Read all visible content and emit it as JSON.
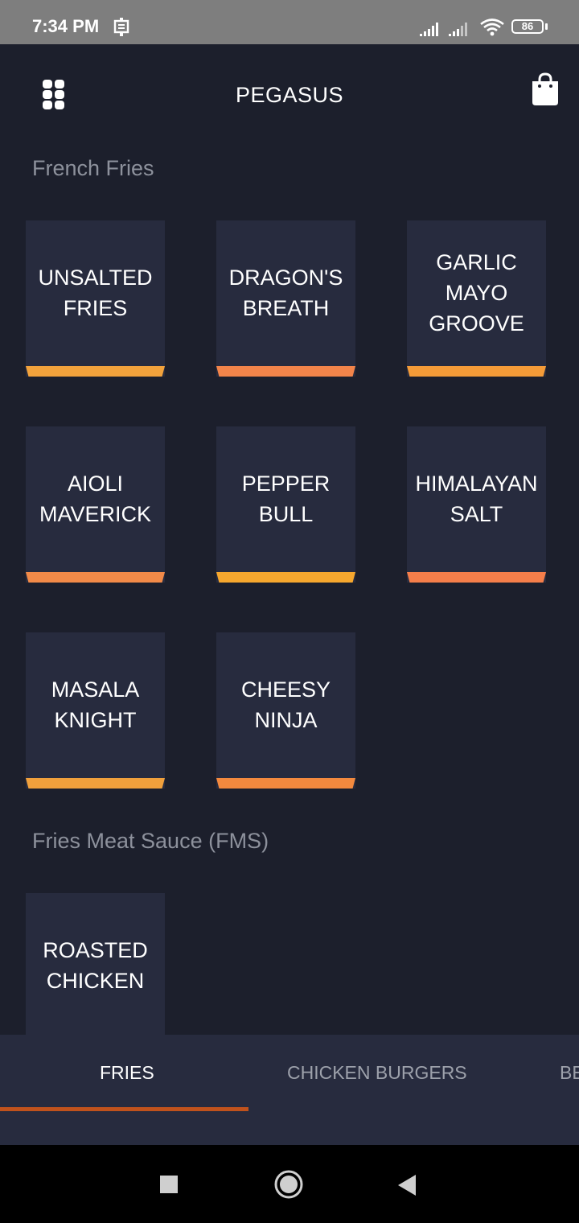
{
  "status_bar": {
    "time": "7:34 PM",
    "battery": "86",
    "icons": [
      "cast-icon",
      "signal-icon",
      "signal-icon",
      "wifi-icon",
      "battery-icon"
    ]
  },
  "header": {
    "title": "PEGASUS",
    "menu_icon": "grid-menu-icon",
    "cart_icon": "shopping-bag-icon"
  },
  "sections": [
    {
      "title": "French Fries",
      "items": [
        {
          "lines": [
            "UNSALTED",
            "FRIES"
          ],
          "accent": "#f2a23c"
        },
        {
          "lines": [
            "DRAGON'S",
            "BREATH"
          ],
          "accent": "#f2844a"
        },
        {
          "lines": [
            "GARLIC",
            "MAYO",
            "GROOVE"
          ],
          "accent": "#f49b38"
        },
        {
          "lines": [
            "AIOLI",
            "MAVERICK"
          ],
          "accent": "#f28a48"
        },
        {
          "lines": [
            "PEPPER",
            "BULL"
          ],
          "accent": "#f6a72e"
        },
        {
          "lines": [
            "HIMALAYAN",
            "SALT"
          ],
          "accent": "#f57e4a"
        },
        {
          "lines": [
            "MASALA",
            "KNIGHT"
          ],
          "accent": "#f0a03c"
        },
        {
          "lines": [
            "CHEESY",
            "NINJA"
          ],
          "accent": "#f3893e"
        }
      ]
    },
    {
      "title": "Fries Meat Sauce (FMS)",
      "items": [
        {
          "lines": [
            "ROASTED",
            "CHICKEN"
          ],
          "accent": "#f2a23c"
        }
      ]
    }
  ],
  "tabs": [
    {
      "label": "FRIES",
      "active": true
    },
    {
      "label": "CHICKEN BURGERS",
      "active": false
    },
    {
      "label": "BEEF BURGERS",
      "active": false
    }
  ],
  "colors": {
    "background": "#1c1f2c",
    "tile": "#272b3e",
    "tab_indicator": "#c0521c"
  }
}
